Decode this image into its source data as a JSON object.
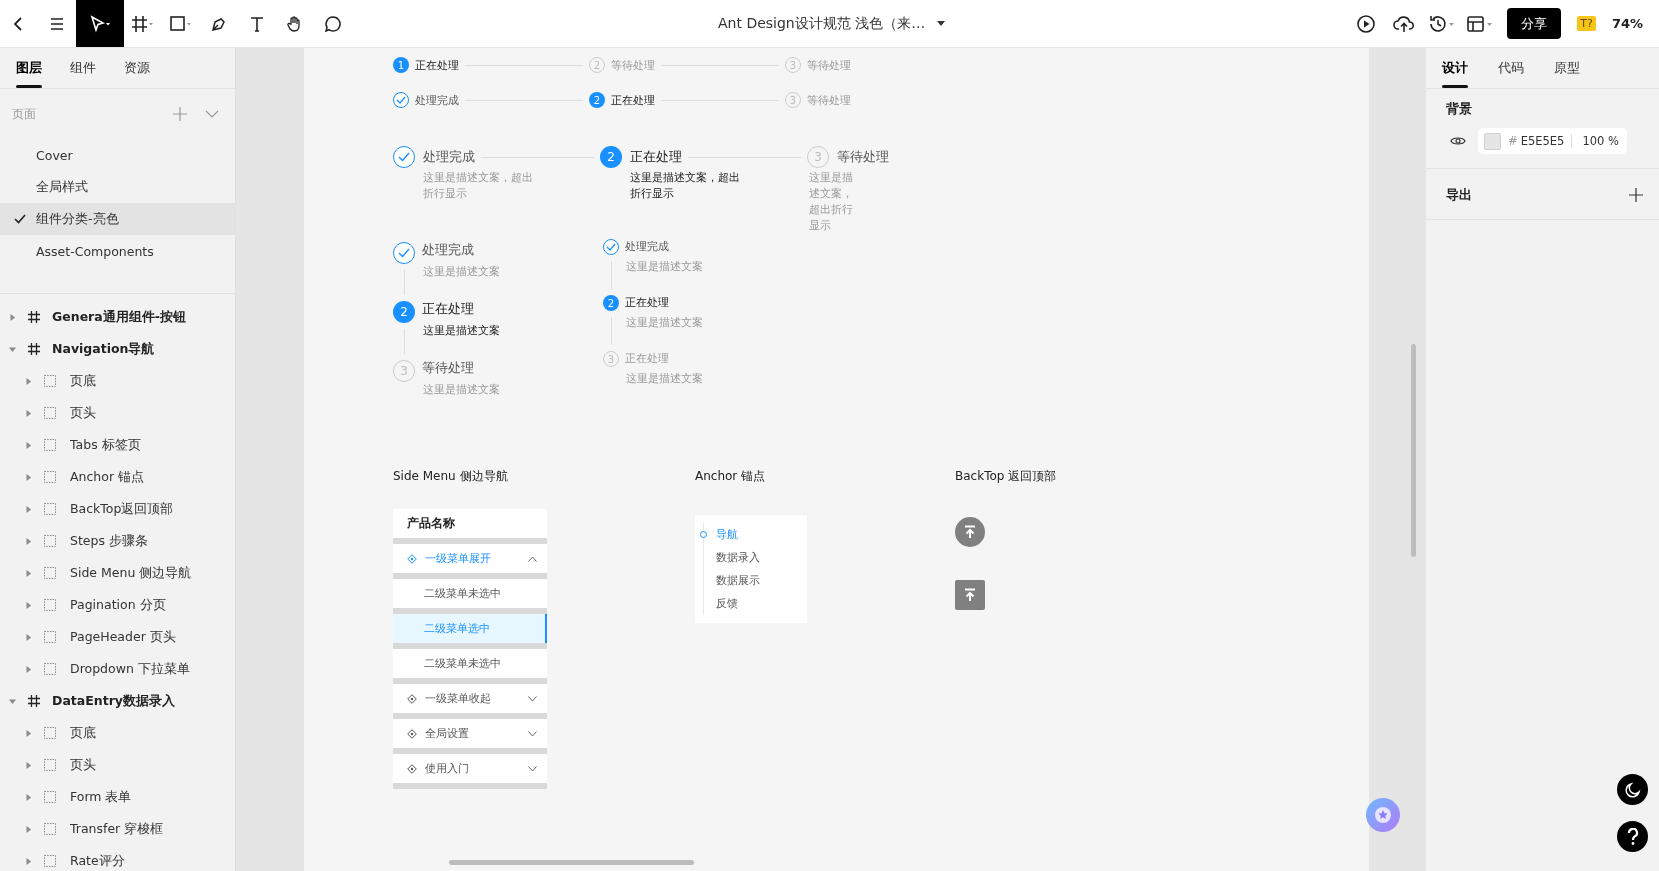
{
  "toolbar": {
    "tools": [
      {
        "kind": "back",
        "selected": false
      },
      {
        "kind": "menu",
        "selected": false
      },
      {
        "kind": "move",
        "selected": true
      },
      {
        "kind": "frame",
        "selected": false
      },
      {
        "kind": "rect",
        "selected": false
      },
      {
        "kind": "pen",
        "selected": false
      },
      {
        "kind": "text",
        "selected": false
      },
      {
        "kind": "hand",
        "selected": false
      },
      {
        "kind": "comment",
        "selected": false
      }
    ],
    "title": "Ant Design设计规范 浅色（来…",
    "actions": [
      {
        "kind": "play"
      },
      {
        "kind": "upload"
      },
      {
        "kind": "history"
      },
      {
        "kind": "layout"
      }
    ],
    "share": "分享",
    "badge": "T?",
    "zoom": "74%"
  },
  "left_panel": {
    "tabs": [
      {
        "label": "图层",
        "selected": true
      },
      {
        "label": "组件",
        "selected": false
      },
      {
        "label": "资源",
        "selected": false
      }
    ],
    "pages_heading": "页面",
    "pages": [
      {
        "label": "Cover",
        "selected": false
      },
      {
        "label": "全局样式",
        "selected": false
      },
      {
        "label": "组件分类-亮色",
        "selected": true
      },
      {
        "label": "Asset-Components",
        "selected": false
      }
    ],
    "layers": [
      {
        "label": "Genera通用组件-按钮",
        "expanded": false
      },
      {
        "label": "Navigation导航",
        "expanded": true,
        "children": [
          {
            "label": "页底",
            "expanded": false
          },
          {
            "label": "页头",
            "expanded": false
          },
          {
            "label": "Tabs 标签页",
            "expanded": false
          },
          {
            "label": "Anchor 锚点",
            "expanded": false
          },
          {
            "label": "BackTop返回顶部",
            "expanded": false
          },
          {
            "label": "Steps 步骤条",
            "expanded": false
          },
          {
            "label": "Side Menu 侧边导航",
            "expanded": false
          },
          {
            "label": "Pagination 分页",
            "expanded": false
          },
          {
            "label": "PageHeader 页头",
            "expanded": false
          },
          {
            "label": "Dropdown 下拉菜单",
            "expanded": false
          }
        ]
      },
      {
        "label": "DataEntry数据录入",
        "expanded": true,
        "children": [
          {
            "label": "页底",
            "expanded": false
          },
          {
            "label": "页头",
            "expanded": false
          },
          {
            "label": "Form 表单",
            "expanded": false
          },
          {
            "label": "Transfer 穿梭框",
            "expanded": false
          },
          {
            "label": "Rate评分",
            "expanded": false
          }
        ]
      }
    ]
  },
  "canvas": {
    "steps_rows": [
      {
        "steps": [
          {
            "done": false,
            "current": true,
            "number": "1",
            "title": "正在处理"
          },
          {
            "done": false,
            "current": false,
            "number": "2",
            "title": "等待处理"
          },
          {
            "done": false,
            "current": false,
            "number": "3",
            "title": "等待处理"
          }
        ]
      },
      {
        "steps": [
          {
            "done": true,
            "current": false,
            "title": "处理完成"
          },
          {
            "done": false,
            "current": true,
            "number": "2",
            "title": "正在处理"
          },
          {
            "done": false,
            "current": false,
            "number": "3",
            "title": "等待处理"
          }
        ]
      }
    ],
    "steps_described": [
      {
        "done": true,
        "current": false,
        "title": "处理完成",
        "description": "这里是描述文案，超出折行显示"
      },
      {
        "done": false,
        "current": true,
        "number": "2",
        "title": "正在处理",
        "description": "这里是描述文案，超出折行显示"
      },
      {
        "done": false,
        "current": false,
        "number": "3",
        "title": "等待处理",
        "description": "这里是描述文案，超出折行显示"
      }
    ],
    "steps_vertical": [
      {
        "done": true,
        "current": false,
        "title": "处理完成",
        "description": "这里是描述文案"
      },
      {
        "done": false,
        "current": true,
        "number": "2",
        "title": "正在处理",
        "description": "这里是描述文案"
      },
      {
        "done": false,
        "current": false,
        "number": "3",
        "title": "等待处理",
        "description": "这里是描述文案"
      }
    ],
    "steps_vertical_small": [
      {
        "done": true,
        "current": false,
        "title": "处理完成",
        "description": "这里是描述文案"
      },
      {
        "done": false,
        "current": true,
        "number": "2",
        "title": "正在处理",
        "description": "这里是描述文案"
      },
      {
        "done": false,
        "current": false,
        "number": "3",
        "title": "正在处理",
        "description": "这里是描述文案"
      }
    ],
    "side_menu": {
      "heading": "Side Menu 侧边导航",
      "product": "产品名称",
      "submenus": [
        {
          "label": "一级菜单展开",
          "expanded": true,
          "children": [
            {
              "label": "二级菜单未选中",
              "selected": false
            },
            {
              "label": "二级菜单选中",
              "selected": true
            },
            {
              "label": "二级菜单未选中",
              "selected": false
            }
          ]
        },
        {
          "label": "一级菜单收起",
          "expanded": false
        },
        {
          "label": "全局设置",
          "expanded": false
        },
        {
          "label": "使用入门",
          "expanded": false
        }
      ]
    },
    "anchor": {
      "heading": "Anchor 锚点",
      "links": [
        {
          "label": "导航",
          "selected": true
        },
        {
          "label": "数据录入",
          "selected": false
        },
        {
          "label": "数据展示",
          "selected": false
        },
        {
          "label": "反馈",
          "selected": false
        }
      ]
    },
    "backtop": {
      "heading": "BackTop 返回顶部"
    }
  },
  "right_panel": {
    "tabs": [
      {
        "label": "设计",
        "selected": true
      },
      {
        "label": "代码",
        "selected": false
      },
      {
        "label": "原型",
        "selected": false
      }
    ],
    "background": {
      "heading": "背景",
      "visible": true,
      "color": "#e5e5e5",
      "hash": "#",
      "hex": "E5E5E5",
      "opacity": "100 %"
    },
    "export": {
      "heading": "导出"
    }
  }
}
